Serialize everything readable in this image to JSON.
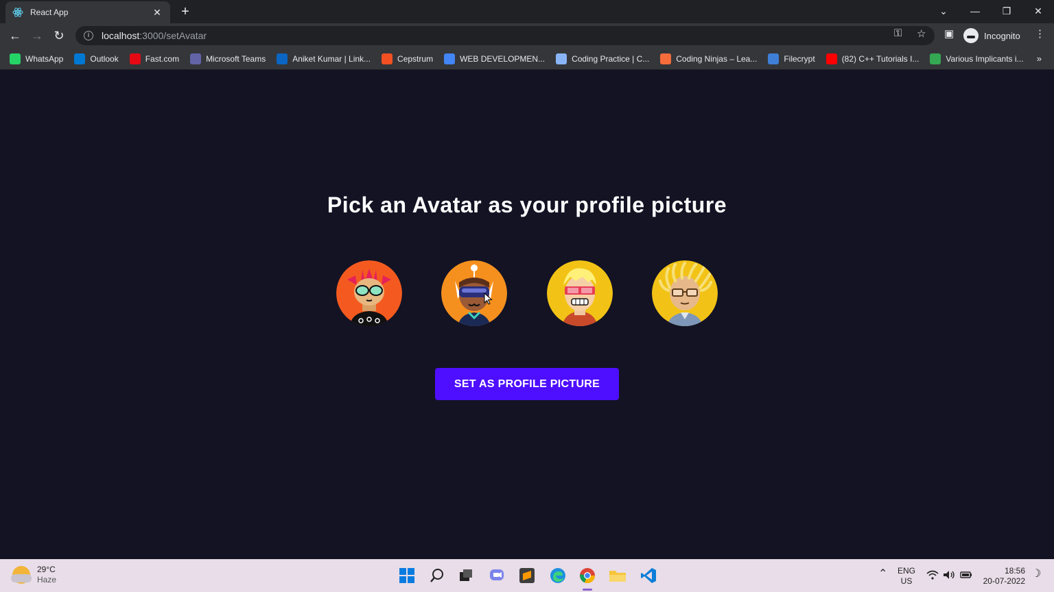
{
  "browser": {
    "tab_title": "React App",
    "tab_close": "✕",
    "new_tab": "+",
    "url_host": "localhost",
    "url_rest": ":3000/setAvatar",
    "incognito_label": "Incognito",
    "bookmarks": [
      {
        "label": "WhatsApp",
        "color": "#25d366"
      },
      {
        "label": "Outlook",
        "color": "#0078d4"
      },
      {
        "label": "Fast.com",
        "color": "#e50914"
      },
      {
        "label": "Microsoft Teams",
        "color": "#6264a7"
      },
      {
        "label": "Aniket Kumar | Link...",
        "color": "#0a66c2"
      },
      {
        "label": "Cepstrum",
        "color": "#f25022"
      },
      {
        "label": "WEB DEVELOPMEN...",
        "color": "#4285f4"
      },
      {
        "label": "Coding Practice | C...",
        "color": "#8ab4f8"
      },
      {
        "label": "Coding Ninjas – Lea...",
        "color": "#f66c3b"
      },
      {
        "label": "Filecrypt",
        "color": "#3f7fd6"
      },
      {
        "label": "(82) C++ Tutorials I...",
        "color": "#ff0000"
      },
      {
        "label": "Various Implicants i...",
        "color": "#34a853"
      }
    ],
    "bookmarks_more": "»"
  },
  "page": {
    "heading": "Pick an Avatar as your profile picture",
    "button_label": "SET AS PROFILE PICTURE",
    "avatars": [
      {
        "name": "avatar-1",
        "bg": "#f45a1f"
      },
      {
        "name": "avatar-2",
        "bg": "#f5901e"
      },
      {
        "name": "avatar-3",
        "bg": "#f2c316"
      },
      {
        "name": "avatar-4",
        "bg": "#f2c316"
      }
    ],
    "colors": {
      "background": "#131324",
      "accent": "#4e0eff"
    }
  },
  "taskbar": {
    "temperature": "29°C",
    "condition": "Haze",
    "lang_top": "ENG",
    "lang_bottom": "US",
    "time": "18:56",
    "date": "20-07-2022"
  }
}
